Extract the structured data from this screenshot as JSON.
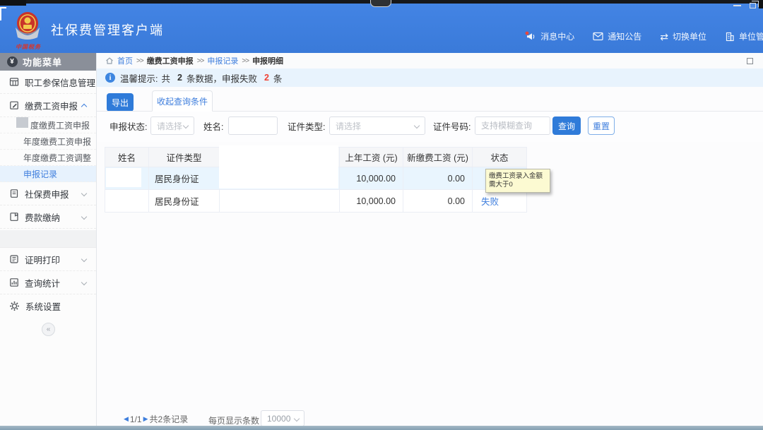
{
  "header": {
    "title": "社保费管理客户端",
    "logo_caption": "中国税务",
    "actions": [
      {
        "label": "消息中心"
      },
      {
        "label": "通知公告"
      },
      {
        "label": "切换单位"
      },
      {
        "label": "单位管理"
      }
    ]
  },
  "sidebar": {
    "title": "功能菜单",
    "yuan_glyph": "¥",
    "items_top": [
      {
        "label": "职工参保信息管理"
      },
      {
        "label": "缴费工资申报"
      }
    ],
    "subitems": [
      {
        "label": "度缴费工资申报"
      },
      {
        "label": "年度缴费工资申报"
      },
      {
        "label": "年度缴费工资调整"
      },
      {
        "label": "申报记录"
      }
    ],
    "items_bottom": [
      {
        "label": "社保费申报"
      },
      {
        "label": "费款缴纳"
      },
      {
        "label": "证明打印"
      },
      {
        "label": "查询统计"
      },
      {
        "label": "系统设置"
      }
    ],
    "collapse_glyph": "«"
  },
  "breadcrumb": {
    "sep": ">>",
    "items": [
      "首页",
      "缴费工资申报",
      "申报记录",
      "申报明细"
    ]
  },
  "notice": {
    "label": "温馨提示:",
    "t1": "共",
    "total": "2",
    "t2": "条数据，申报失败",
    "failed": "2",
    "t3": "条"
  },
  "toolbar": {
    "export": "导出",
    "collapse": "收起查询条件"
  },
  "filters": {
    "status_label": "申报状态:",
    "status_value": "请选择",
    "name_label": "姓名:",
    "cert_type_label": "证件类型:",
    "cert_type_value": "请选择",
    "cert_no_label": "证件号码:",
    "cert_no_placeholder": "支持模糊查询",
    "search": "查询",
    "reset": "重置"
  },
  "table": {
    "columns": [
      "姓名",
      "证件类型",
      "",
      "上年工资 (元)",
      "新缴费工资 (元)",
      "状态"
    ],
    "rows": [
      {
        "cert_type": "居民身份证",
        "salary_prev": "10,000.00",
        "salary_new": "0.00",
        "status": ""
      },
      {
        "cert_type": "居民身份证",
        "salary_prev": "10,000.00",
        "salary_new": "0.00",
        "status": "失败"
      }
    ],
    "tooltip": "缴费工资录入金额需大于0"
  },
  "pagination": {
    "prev": "◀",
    "page": "1/1",
    "next": "▶",
    "total": "共2条记录",
    "size_label": "每页显示条数",
    "size_value": "10000"
  },
  "colors": {
    "header_blue": "#3D7EDC",
    "accent_blue": "#2F7BD9",
    "link_blue": "#3E7EDD",
    "notice_bg": "#E8F3FD",
    "fail_red": "#F04134",
    "tooltip_bg": "#FCFAD2",
    "row_highlight": "#E9F5FE"
  }
}
